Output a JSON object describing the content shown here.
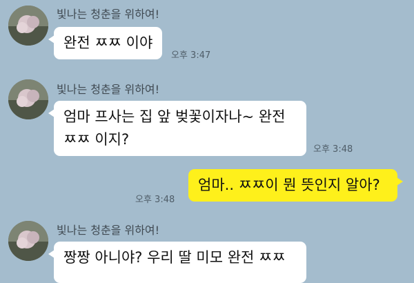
{
  "colors": {
    "background": "#a4bccd",
    "incoming_bubble": "#ffffff",
    "outgoing_bubble": "#fef01b"
  },
  "messages": [
    {
      "sender": "빛나는 청춘을 위하여!",
      "text": "완전 ㅉㅉ 이야",
      "time": "오후 3:47"
    },
    {
      "sender": "빛나는 청춘을 위하여!",
      "line1": "엄마 프사는 집 앞 벚꽃이자나~ 완전",
      "line2": "ㅉㅉ 이지?",
      "time": "오후 3:48"
    },
    {
      "text": "엄마.. ㅉㅉ이 뭔 뜻인지 알아?",
      "time": "오후 3:48"
    },
    {
      "sender": "빛나는 청춘을 위하여!",
      "text": "짱짱 아니야? 우리 딸 미모 완전 ㅉㅉ"
    }
  ]
}
